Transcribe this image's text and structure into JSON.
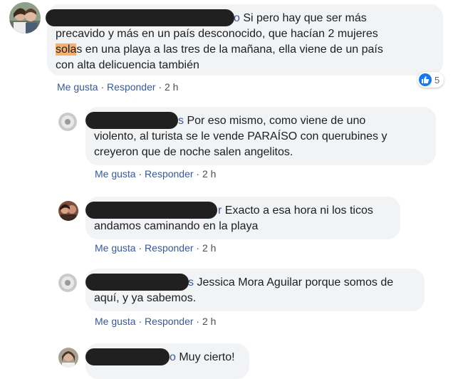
{
  "actions": {
    "like": "Me gusta",
    "sep": " · ",
    "reply": "Responder",
    "time": "2 h"
  },
  "comments": [
    {
      "author_tail": "o",
      "lines": [
        " Si pero hay que ser más",
        "precavido y más en un país desconocido, que hacían 2 mujeres",
        "sola",
        "s en una playa a las tres de la mañana, ella viene de un país",
        "con alta delicuencia también"
      ],
      "reactions": {
        "icon": "like-icon",
        "count": "5"
      }
    },
    {
      "author_tail": "s",
      "lines": [
        " Por eso mismo, como viene de uno",
        "violento, al turista se le vende PARAÍSO con querubines y",
        "creyeron que de noche salen angelitos."
      ]
    },
    {
      "author_tail": "r",
      "lines": [
        " Exacto a esa hora ni los ticos",
        "andamos caminando en la playa"
      ]
    },
    {
      "author_tail": "s",
      "lines": [
        " Jessica Mora Aguilar porque somos de",
        "aquí, y ya sabemos."
      ]
    },
    {
      "author_tail": "o",
      "lines": [
        " Muy cierto!"
      ]
    }
  ],
  "colors": {
    "author": "#385898",
    "bubble": "#f2f3f5",
    "highlight": "#f7b16f",
    "like": "#1877f2"
  }
}
